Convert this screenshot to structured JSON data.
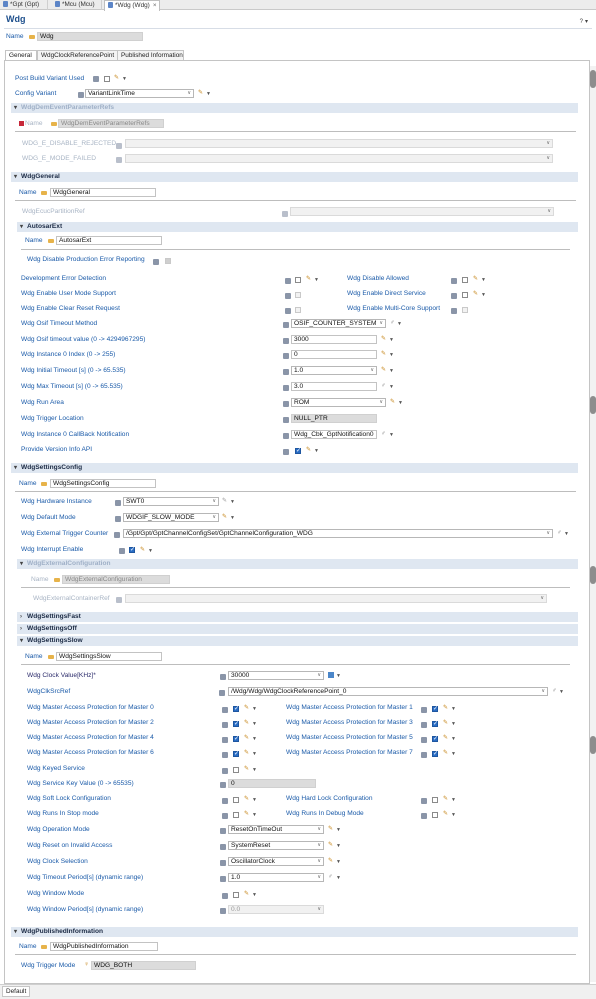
{
  "editor_tabs": [
    "*Gpt (Gpt)",
    "*Mcu (Mcu)",
    "*Wdg (Wdg)"
  ],
  "title": "Wdg",
  "name_label": "Name",
  "name_value": "Wdg",
  "page_tabs": [
    "General",
    "WdgClockReferencePoint",
    "Published Information"
  ],
  "general": {
    "post_build_label": "Post Build Variant Used",
    "config_variant_label": "Config Variant",
    "config_variant_value": "VariantLinkTime"
  },
  "dem": {
    "header": "WdgDemEventParameterRefs",
    "name_label": "Name",
    "name_value": "WdgDemEventParameterRefs",
    "disable_rejected_label": "WDG_E_DISABLE_REJECTED",
    "mode_failed_label": "WDG_E_MODE_FAILED"
  },
  "wdg_general": {
    "header": "WdgGeneral",
    "name_label": "Name",
    "name_value": "WdgGeneral",
    "ecuc_label": "WdgEcucPartitionRef"
  },
  "autosar_ext": {
    "header": "AutosarExt",
    "name_label": "Name",
    "name_value": "AutosarExt",
    "disable_prod_label": "Wdg Disable Production Error Reporting",
    "dev_error_label": "Development Error Detection",
    "disable_allowed_label": "Wdg Disable Allowed",
    "user_mode_label": "Wdg Enable User Mode Support",
    "direct_service_label": "Wdg Enable Direct Service",
    "clear_reset_label": "Wdg Enable Clear Reset Request",
    "multicore_label": "Wdg Enable Multi-Core Support",
    "osif_method_label": "Wdg Osif Timeout Method",
    "osif_method_value": "OSIF_COUNTER_SYSTEM",
    "osif_value_label": "Wdg Osif timeout value (0 -> 4294967295)",
    "osif_value_value": "3000",
    "instance_label": "Wdg Instance 0 Index (0 -> 255)",
    "instance_value": "0",
    "initial_timeout_label": "Wdg Initial Timeout [s] (0 -> 65.535)",
    "initial_timeout_value": "1.0",
    "max_timeout_label": "Wdg Max Timeout [s] (0 -> 65.535)",
    "max_timeout_value": "3.0",
    "run_area_label": "Wdg Run Area",
    "run_area_value": "ROM",
    "trigger_location_label": "Wdg Trigger Location",
    "trigger_location_value": "NULL_PTR",
    "callback_label": "Wdg Instance 0 CallBack Notification",
    "callback_value": "Wdg_Cbk_GptNotification0",
    "version_api_label": "Provide Version Info API"
  },
  "settings_config": {
    "header": "WdgSettingsConfig",
    "name_label": "Name",
    "name_value": "WdgSettingsConfig",
    "hw_instance_label": "Wdg Hardware Instance",
    "hw_instance_value": "SWT0",
    "default_mode_label": "Wdg Default Mode",
    "default_mode_value": "WDGIF_SLOW_MODE",
    "ext_trigger_label": "Wdg External Trigger Counter",
    "ext_trigger_value": "/Gpt/Gpt/GptChannelConfigSet/GptChannelConfiguration_WDG",
    "interrupt_label": "Wdg Interrupt Enable"
  },
  "external_config": {
    "header": "WdgExternalConfiguration",
    "name_label": "Name",
    "name_value": "WdgExternalConfiguration",
    "container_ref_label": "WdgExternalContainerRef"
  },
  "settings_fast": {
    "header": "WdgSettingsFast"
  },
  "settings_off": {
    "header": "WdgSettingsOff"
  },
  "settings_slow": {
    "header": "WdgSettingsSlow",
    "name_label": "Name",
    "name_value": "WdgSettingsSlow",
    "clock_value_label": "Wdg Clock Value[KHz]*",
    "clock_value_value": "30000",
    "clk_src_label": "WdgClkSrcRef",
    "clk_src_value": "/Wdg/Wdg/WdgClockReferencePoint_0",
    "map0_label": "Wdg Master Access Protection for Master 0",
    "map1_label": "Wdg Master Access Protection for Master 1",
    "map2_label": "Wdg Master Access Protection for Master 2",
    "map3_label": "Wdg Master Access Protection for Master 3",
    "map4_label": "Wdg Master Access Protection for Master 4",
    "map5_label": "Wdg Master Access Protection for Master 5",
    "map6_label": "Wdg Master Access Protection for Master 6",
    "map7_label": "Wdg Master Access Protection for Master 7",
    "keyed_service_label": "Wdg Keyed Service",
    "service_key_label": "Wdg Service Key Value (0 -> 65535)",
    "service_key_value": "0",
    "soft_lock_label": "Wdg Soft Lock Configuration",
    "hard_lock_label": "Wdg Hard Lock Configuration",
    "runs_stop_label": "Wdg Runs In Stop mode",
    "runs_debug_label": "Wdg Runs In Debug Mode",
    "op_mode_label": "Wdg Operation Mode",
    "op_mode_value": "ResetOnTimeOut",
    "reset_invalid_label": "Wdg Reset on Invalid Access",
    "reset_invalid_value": "SystemReset",
    "clock_sel_label": "Wdg Clock Selection",
    "clock_sel_value": "OscillatorClock",
    "timeout_period_label": "Wdg Timeout Period[s] (dynamic range)",
    "timeout_period_value": "1.0",
    "window_mode_label": "Wdg Window Mode",
    "window_period_label": "Wdg Window Period[s] (dynamic range)",
    "window_period_value": "0.0"
  },
  "published": {
    "header": "WdgPublishedInformation",
    "name_label": "Name",
    "name_value": "WdgPublishedInformation",
    "trigger_mode_label": "Wdg Trigger Mode",
    "trigger_mode_value": "WDG_BOTH"
  },
  "statusbar": {
    "tab": "Default"
  },
  "colors": {
    "section_bg": "#dfe7f1",
    "link_label": "#1a5aa8",
    "checked": "#2a6dc4"
  }
}
